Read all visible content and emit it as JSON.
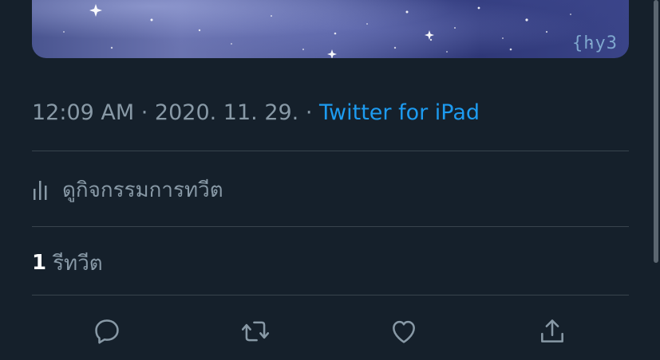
{
  "media": {
    "watermark_text": "{hy3"
  },
  "meta": {
    "time": "12:09 AM",
    "separator": " · ",
    "date": "2020. 11. 29.",
    "source": "Twitter for iPad"
  },
  "activity": {
    "icon": "bar-chart-icon",
    "label": "ดูกิจกรรมการทวีต"
  },
  "retweets": {
    "count": "1",
    "label": "รีทวีต"
  },
  "actions": {
    "reply_icon": "reply-icon",
    "retweet_icon": "retweet-icon",
    "like_icon": "heart-icon",
    "share_icon": "share-icon"
  },
  "colors": {
    "background": "#15202b",
    "secondary_text": "#8899a6",
    "link": "#1d9bf0",
    "divider": "#38444d",
    "primary_text": "#ffffff"
  }
}
